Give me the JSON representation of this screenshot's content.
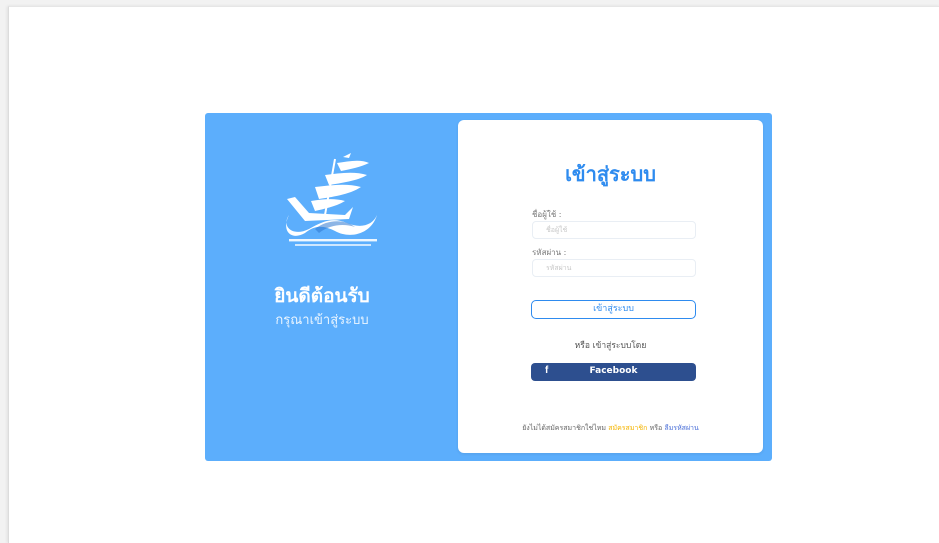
{
  "welcome_panel": {
    "title": "ยินดีต้อนรับ",
    "subtitle": "กรุณาเข้าสู่ระบบ",
    "logo_icon": "ship-logo-icon"
  },
  "login_form": {
    "title": "เข้าสู่ระบบ",
    "username_label": "ชื่อผู้ใช้ :",
    "username_placeholder": "ชื่อผู้ใช้",
    "username_value": "",
    "password_label": "รหัสผ่าน :",
    "password_placeholder": "รหัสผ่าน",
    "password_value": "",
    "login_button": "เข้าสู่ระบบ",
    "or_text": "หรือ เข้าสู่ระบบโดย",
    "facebook_icon": "f",
    "facebook_button": "Facebook"
  },
  "footer": {
    "prefix": "ยังไม่ได้สมัครสมาชิกใช่ไหม",
    "register_link": "สมัครสมาชิก",
    "or_word": "หรือ",
    "forgot_link": "ลืมรหัสผ่าน"
  },
  "colors": {
    "card_background": "#5caefc",
    "accent": "#2e8bef",
    "facebook": "#2d4f8f",
    "register_link": "#f4b400",
    "forgot_link": "#4a6fd8"
  }
}
